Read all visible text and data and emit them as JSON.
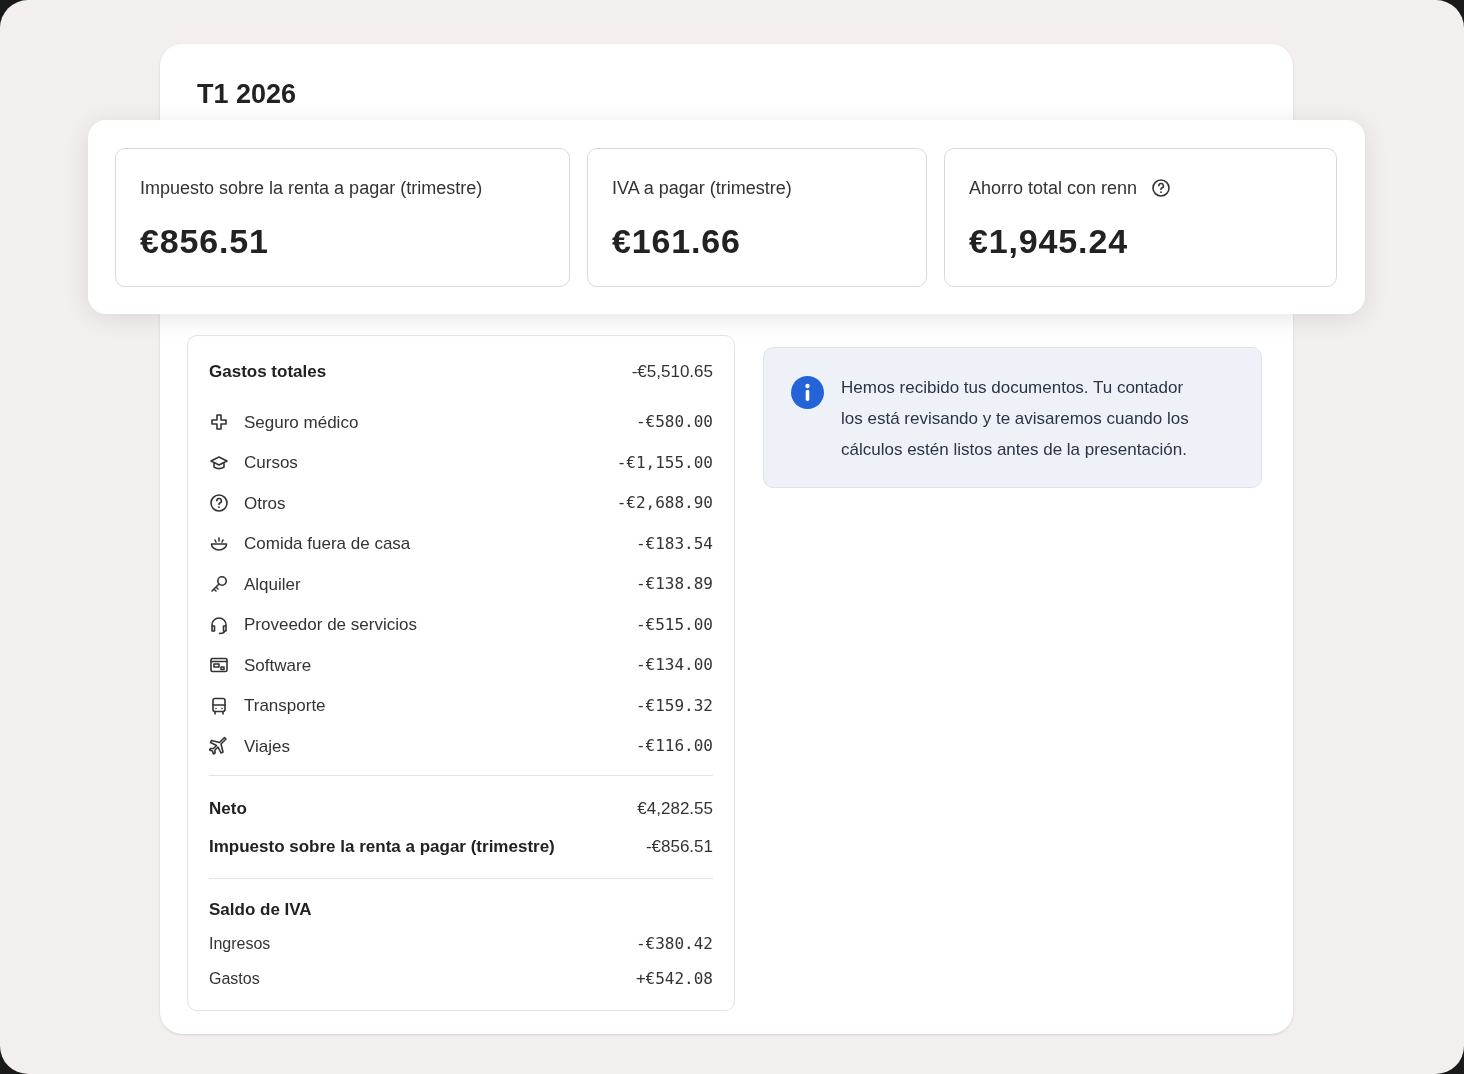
{
  "title": "T1 2026",
  "summary": [
    {
      "label": "Impuesto sobre la renta a pagar (trimestre)",
      "value": "€856.51",
      "help": false
    },
    {
      "label": "IVA a pagar (trimestre)",
      "value": "€161.66",
      "help": false
    },
    {
      "label": "Ahorro total con renn",
      "value": "€1,945.24",
      "help": true
    }
  ],
  "expenses": {
    "label": "Gastos totales",
    "amount": "-€5,510.65",
    "items": [
      {
        "label": "Seguro médico",
        "amount": "-€580.00"
      },
      {
        "label": "Cursos",
        "amount": "-€1,155.00"
      },
      {
        "label": "Otros",
        "amount": "-€2,688.90"
      },
      {
        "label": "Comida fuera de casa",
        "amount": "-€183.54"
      },
      {
        "label": "Alquiler",
        "amount": "-€138.89"
      },
      {
        "label": "Proveedor de servicios",
        "amount": "-€515.00"
      },
      {
        "label": "Software",
        "amount": "-€134.00"
      },
      {
        "label": "Transporte",
        "amount": "-€159.32"
      },
      {
        "label": "Viajes",
        "amount": "-€116.00"
      }
    ]
  },
  "net": [
    {
      "label": "Neto",
      "amount": "€4,282.55"
    },
    {
      "label": "Impuesto sobre la renta a pagar (trimestre)",
      "amount": "-€856.51"
    }
  ],
  "vat": {
    "title": "Saldo de IVA",
    "items": [
      {
        "label": "Ingresos",
        "amount": "-€380.42"
      },
      {
        "label": "Gastos",
        "amount": "+€542.08"
      }
    ]
  },
  "notice": {
    "text": "Hemos recibido tus documentos. Tu contador los está revisando y te avisaremos cuando los cálculos estén listos antes de la presentación."
  }
}
